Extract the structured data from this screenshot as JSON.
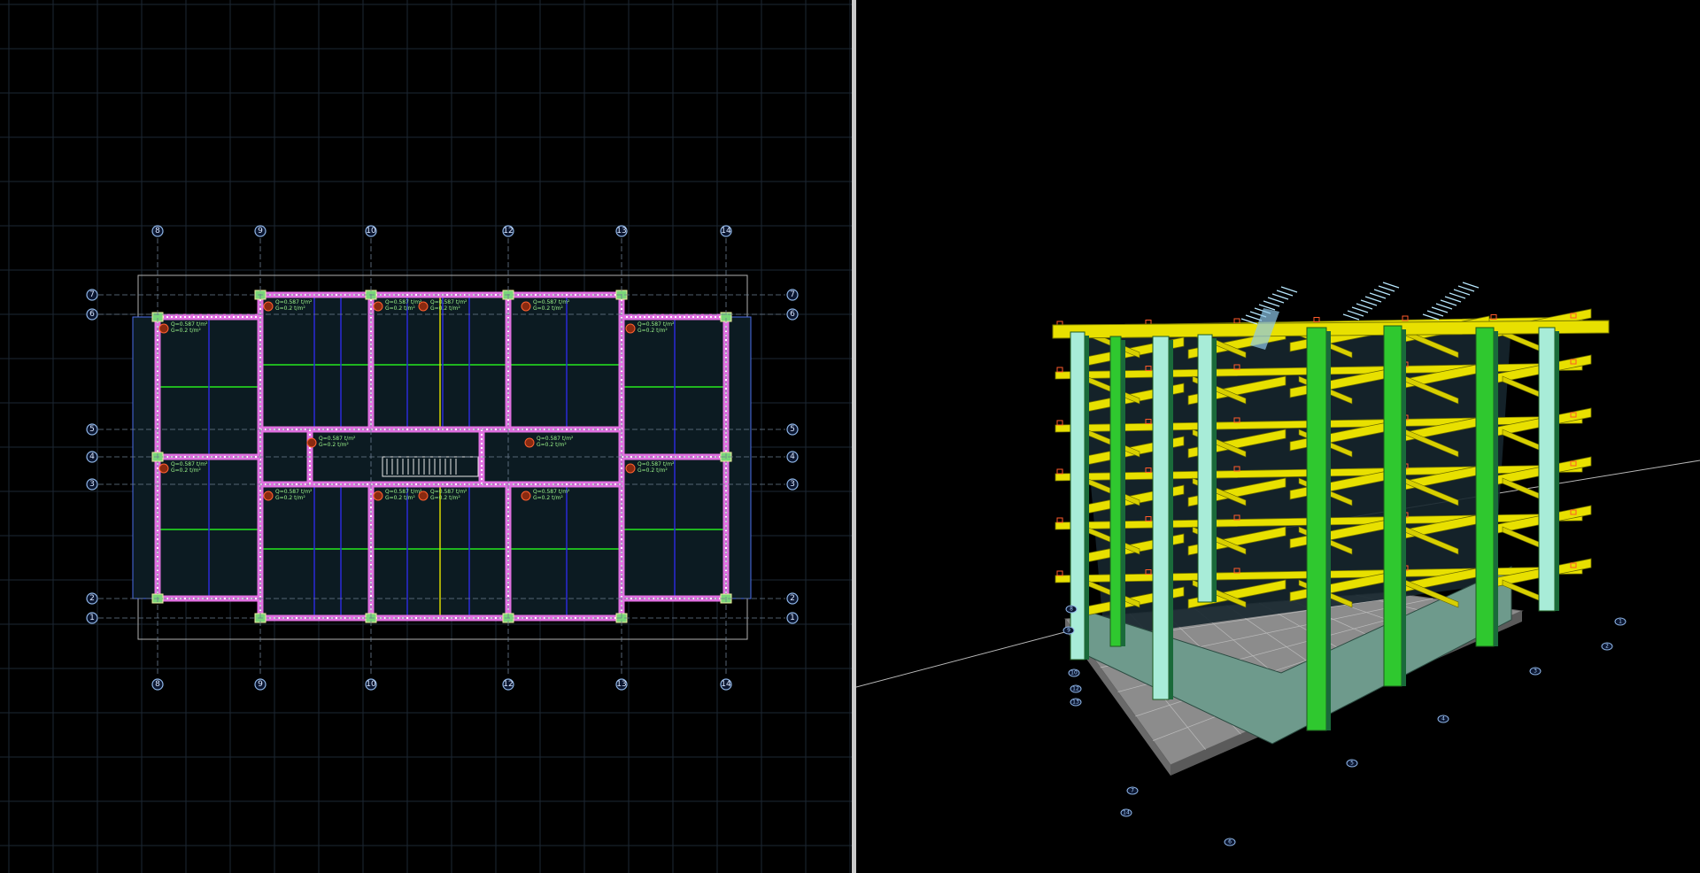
{
  "viewports": {
    "plan": {
      "name": "plan-view",
      "grid_axes_x": [
        "8",
        "9",
        "10",
        "12",
        "13",
        "14"
      ],
      "grid_axes_y": [
        "7",
        "6",
        "5",
        "4",
        "3",
        "2",
        "1"
      ],
      "slab_labels": [
        {
          "l1": "Q=0.587 t/m²",
          "l2": "G=0.2 t/m²"
        },
        {
          "l1": "Q=0.587 t/m²",
          "l2": "G=0.2 t/m²"
        },
        {
          "l1": "Q=0.587 t/m²",
          "l2": "G=0.2 t/m²"
        },
        {
          "l1": "Q=0.587 t/m²",
          "l2": "G=0.2 t/m²"
        },
        {
          "l1": "Q=0.587 t/m²",
          "l2": "G=0.2 t/m²"
        },
        {
          "l1": "Q=0.587 t/m²",
          "l2": "G=0.2 t/m²"
        },
        {
          "l1": "Q=0.587 t/m²",
          "l2": "G=0.2 t/m²"
        },
        {
          "l1": "Q=0.587 t/m²",
          "l2": "G=0.2 t/m²"
        },
        {
          "l1": "Q=0.587 t/m²",
          "l2": "G=0.2 t/m²"
        },
        {
          "l1": "Q=0.587 t/m²",
          "l2": "G=0.2 t/m²"
        },
        {
          "l1": "Q=0.587 t/m²",
          "l2": "G=0.2 t/m²"
        },
        {
          "l1": "Q=0.587 t/m²",
          "l2": "G=0.2 t/m²"
        },
        {
          "l1": "Q=0.587 t/m²",
          "l2": "G=0.2 t/m²"
        },
        {
          "l1": "Q=0.587 t/m²",
          "l2": "G=0.2 t/m²"
        }
      ],
      "colors": {
        "background": "#000000",
        "gridline": "#1c2733",
        "slab_fill": "#0c1b22",
        "wall": "#e070e0",
        "beam_green": "#1fb51f",
        "beam_blue": "#2b2bd8",
        "axis_bubble": "#8fb6e8"
      }
    },
    "model3d": {
      "name": "3d-view",
      "node_labels": [
        "8",
        "9",
        "10",
        "12",
        "13",
        "14",
        "7",
        "6",
        "5",
        "4",
        "3",
        "2",
        "1"
      ],
      "colors": {
        "background": "#000000",
        "beam_yellow": "#e8e000",
        "column_green": "#2fc82f",
        "column_mint": "#a8ecd8",
        "foundation": "#8c8c8c",
        "node_marker": "#ff5a2a"
      }
    }
  }
}
